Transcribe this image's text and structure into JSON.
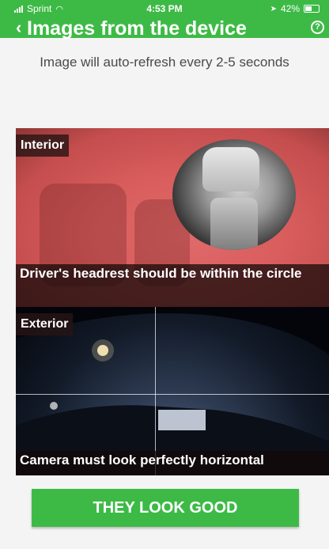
{
  "status_bar": {
    "carrier": "Sprint",
    "time": "4:53 PM",
    "battery": "42%"
  },
  "header": {
    "title": "Images from the device",
    "help_glyph": "?"
  },
  "subtitle": "Image will auto-refresh every 2-5 seconds",
  "interior": {
    "label": "Interior",
    "caption": "Driver's headrest should be within the circle"
  },
  "exterior": {
    "label": "Exterior",
    "caption": "Camera must look perfectly horizontal"
  },
  "confirm_button": "THEY LOOK GOOD",
  "colors": {
    "accent": "#3dba46",
    "interior_tint": "#d95d5d"
  },
  "icons": [
    "signal-icon",
    "wifi-icon",
    "location-icon",
    "battery-icon",
    "back-icon",
    "help-icon"
  ]
}
